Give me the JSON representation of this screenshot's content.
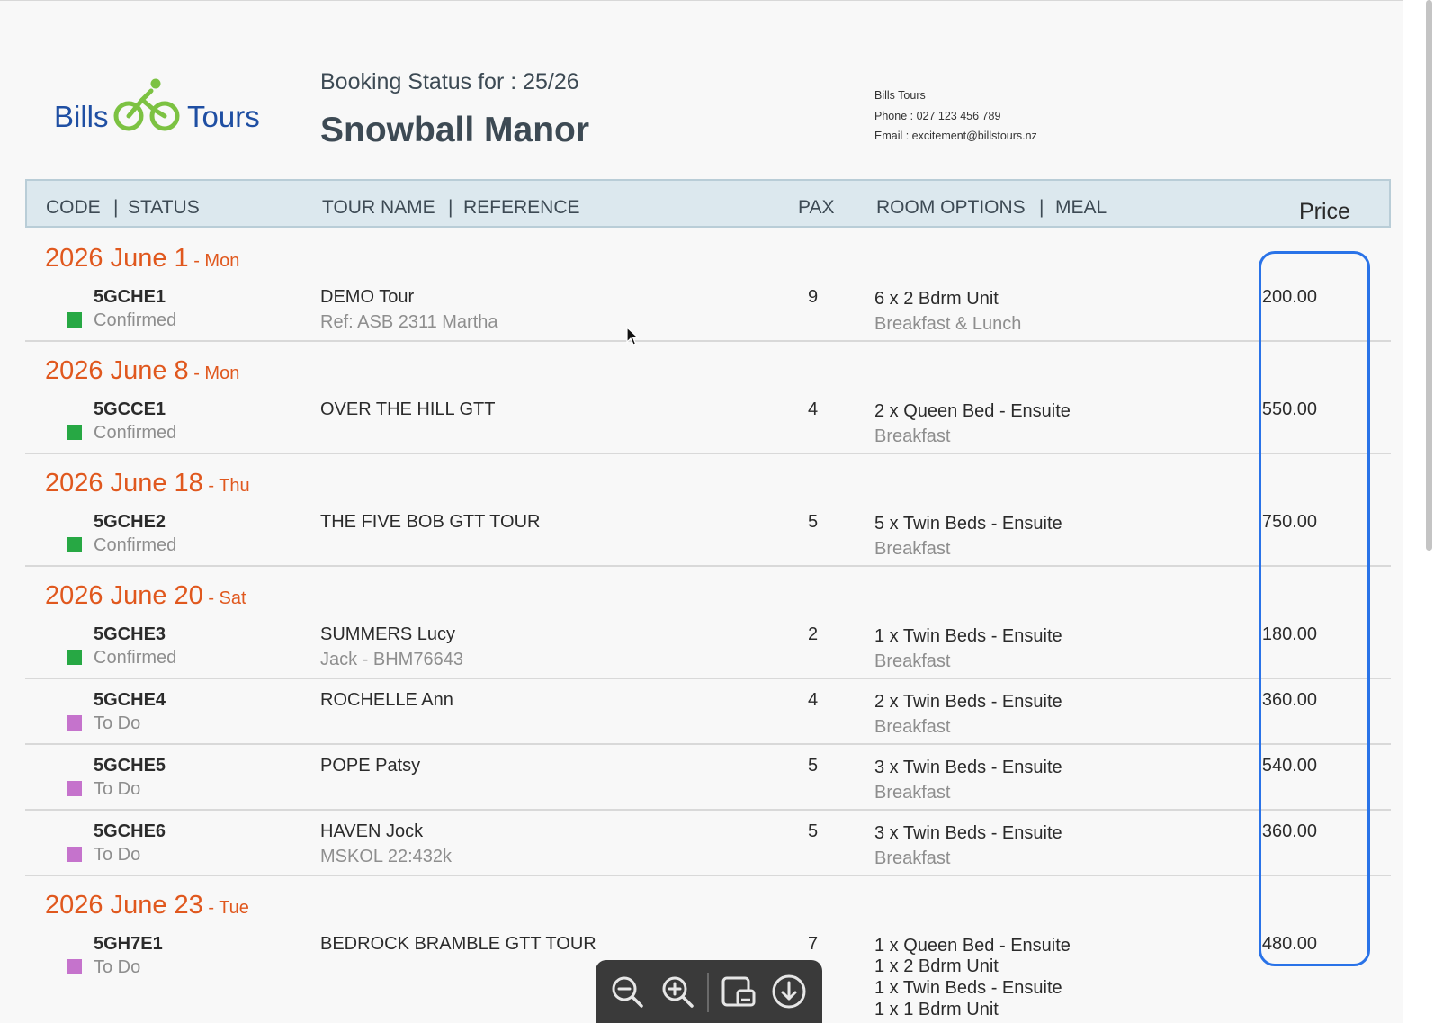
{
  "logo": {
    "left": "Bills",
    "right": "Tours"
  },
  "header": {
    "subtitle": "Booking Status for : 25/26",
    "title": "Snowball Manor"
  },
  "contact": {
    "company": "Bills Tours",
    "phone": "Phone : 027 123 456 789",
    "email": "Email : excitement@billstours.nz"
  },
  "columns": {
    "code": "CODE",
    "status": "STATUS",
    "tour_name": "TOUR NAME",
    "reference": "REFERENCE",
    "pax": "PAX",
    "room_options": "ROOM OPTIONS",
    "meal": "MEAL",
    "price": "Price",
    "separator": "|"
  },
  "dates": [
    {
      "label": "2026 June 1",
      "dow": " - Mon"
    },
    {
      "label": "2026 June 8",
      "dow": " - Mon"
    },
    {
      "label": "2026 June 18",
      "dow": " - Thu"
    },
    {
      "label": "2026 June 20",
      "dow": " - Sat"
    },
    {
      "label": "2026 June 23",
      "dow": " - Tue"
    }
  ],
  "bookings": [
    {
      "code": "5GCHE1",
      "status": "Confirmed",
      "status_color": "#27a844",
      "tour": "DEMO Tour",
      "ref": "Ref: ASB 2311 Martha",
      "pax": "9",
      "room": [
        "6 x 2 Bdrm Unit"
      ],
      "meal": "Breakfast & Lunch",
      "price": "200.00"
    },
    {
      "code": "5GCCE1",
      "status": "Confirmed",
      "status_color": "#27a844",
      "tour": "OVER THE HILL GTT",
      "ref": "",
      "pax": "4",
      "room": [
        "2 x Queen Bed - Ensuite"
      ],
      "meal": "Breakfast",
      "price": "550.00"
    },
    {
      "code": "5GCHE2",
      "status": "Confirmed",
      "status_color": "#27a844",
      "tour": "THE FIVE BOB GTT TOUR",
      "ref": "",
      "pax": "5",
      "room": [
        "5 x Twin Beds - Ensuite"
      ],
      "meal": "Breakfast",
      "price": "750.00"
    },
    {
      "code": "5GCHE3",
      "status": "Confirmed",
      "status_color": "#27a844",
      "tour": "SUMMERS Lucy",
      "ref": "Jack - BHM76643",
      "pax": "2",
      "room": [
        "1 x Twin Beds - Ensuite"
      ],
      "meal": "Breakfast",
      "price": "180.00"
    },
    {
      "code": "5GCHE4",
      "status": "To Do",
      "status_color": "#c573cc",
      "tour": "ROCHELLE Ann",
      "ref": "",
      "pax": "4",
      "room": [
        "2 x Twin Beds - Ensuite"
      ],
      "meal": "Breakfast",
      "price": "360.00"
    },
    {
      "code": "5GCHE5",
      "status": "To Do",
      "status_color": "#c573cc",
      "tour": "POPE Patsy",
      "ref": "",
      "pax": "5",
      "room": [
        "3 x Twin Beds - Ensuite"
      ],
      "meal": "Breakfast",
      "price": "540.00"
    },
    {
      "code": "5GCHE6",
      "status": "To Do",
      "status_color": "#c573cc",
      "tour": "HAVEN Jock",
      "ref": "MSKOL 22:432k",
      "pax": "5",
      "room": [
        "3 x Twin Beds - Ensuite"
      ],
      "meal": "Breakfast",
      "price": "360.00"
    },
    {
      "code": "5GH7E1",
      "status": "To Do",
      "status_color": "#c573cc",
      "tour": "BEDROCK BRAMBLE GTT TOUR",
      "ref": "",
      "pax": "7",
      "room": [
        "1 x Queen Bed - Ensuite",
        "1 x 2 Bdrm Unit",
        "1 x Twin Beds - Ensuite",
        "1 x 1 Bdrm Unit"
      ],
      "meal": "",
      "price": "480.00"
    }
  ],
  "toolbar": {
    "icons": [
      "zoom-out-icon",
      "zoom-in-icon",
      "print-icon",
      "download-icon"
    ]
  },
  "colors": {
    "accent": "#e0581e",
    "confirmed": "#27a844",
    "todo": "#c573cc",
    "highlight": "#2a73e8",
    "logo": "#1f4fa3",
    "bike": "#7cc242"
  }
}
